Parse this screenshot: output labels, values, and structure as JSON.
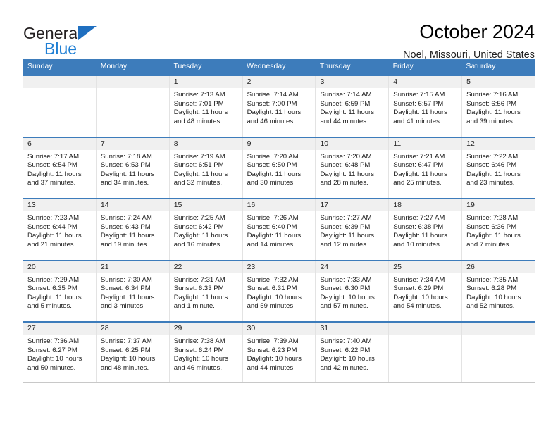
{
  "brand": {
    "name_top": "General",
    "name_bottom": "Blue",
    "triangle_color": "#1f6fc0",
    "blue_color": "#1f7fd4"
  },
  "header": {
    "title": "October 2024",
    "subtitle": "Noel, Missouri, United States"
  },
  "theme": {
    "header_bg": "#3d7cbb",
    "row_border": "#3d7cbb",
    "daynum_bg": "#f0f0f0"
  },
  "weekdays": [
    "Sunday",
    "Monday",
    "Tuesday",
    "Wednesday",
    "Thursday",
    "Friday",
    "Saturday"
  ],
  "weeks": [
    [
      {
        "day": "",
        "empty": true
      },
      {
        "day": "",
        "empty": true
      },
      {
        "day": "1",
        "sunrise": "Sunrise: 7:13 AM",
        "sunset": "Sunset: 7:01 PM",
        "daylight": "Daylight: 11 hours and 48 minutes."
      },
      {
        "day": "2",
        "sunrise": "Sunrise: 7:14 AM",
        "sunset": "Sunset: 7:00 PM",
        "daylight": "Daylight: 11 hours and 46 minutes."
      },
      {
        "day": "3",
        "sunrise": "Sunrise: 7:14 AM",
        "sunset": "Sunset: 6:59 PM",
        "daylight": "Daylight: 11 hours and 44 minutes."
      },
      {
        "day": "4",
        "sunrise": "Sunrise: 7:15 AM",
        "sunset": "Sunset: 6:57 PM",
        "daylight": "Daylight: 11 hours and 41 minutes."
      },
      {
        "day": "5",
        "sunrise": "Sunrise: 7:16 AM",
        "sunset": "Sunset: 6:56 PM",
        "daylight": "Daylight: 11 hours and 39 minutes."
      }
    ],
    [
      {
        "day": "6",
        "sunrise": "Sunrise: 7:17 AM",
        "sunset": "Sunset: 6:54 PM",
        "daylight": "Daylight: 11 hours and 37 minutes."
      },
      {
        "day": "7",
        "sunrise": "Sunrise: 7:18 AM",
        "sunset": "Sunset: 6:53 PM",
        "daylight": "Daylight: 11 hours and 34 minutes."
      },
      {
        "day": "8",
        "sunrise": "Sunrise: 7:19 AM",
        "sunset": "Sunset: 6:51 PM",
        "daylight": "Daylight: 11 hours and 32 minutes."
      },
      {
        "day": "9",
        "sunrise": "Sunrise: 7:20 AM",
        "sunset": "Sunset: 6:50 PM",
        "daylight": "Daylight: 11 hours and 30 minutes."
      },
      {
        "day": "10",
        "sunrise": "Sunrise: 7:20 AM",
        "sunset": "Sunset: 6:48 PM",
        "daylight": "Daylight: 11 hours and 28 minutes."
      },
      {
        "day": "11",
        "sunrise": "Sunrise: 7:21 AM",
        "sunset": "Sunset: 6:47 PM",
        "daylight": "Daylight: 11 hours and 25 minutes."
      },
      {
        "day": "12",
        "sunrise": "Sunrise: 7:22 AM",
        "sunset": "Sunset: 6:46 PM",
        "daylight": "Daylight: 11 hours and 23 minutes."
      }
    ],
    [
      {
        "day": "13",
        "sunrise": "Sunrise: 7:23 AM",
        "sunset": "Sunset: 6:44 PM",
        "daylight": "Daylight: 11 hours and 21 minutes."
      },
      {
        "day": "14",
        "sunrise": "Sunrise: 7:24 AM",
        "sunset": "Sunset: 6:43 PM",
        "daylight": "Daylight: 11 hours and 19 minutes."
      },
      {
        "day": "15",
        "sunrise": "Sunrise: 7:25 AM",
        "sunset": "Sunset: 6:42 PM",
        "daylight": "Daylight: 11 hours and 16 minutes."
      },
      {
        "day": "16",
        "sunrise": "Sunrise: 7:26 AM",
        "sunset": "Sunset: 6:40 PM",
        "daylight": "Daylight: 11 hours and 14 minutes."
      },
      {
        "day": "17",
        "sunrise": "Sunrise: 7:27 AM",
        "sunset": "Sunset: 6:39 PM",
        "daylight": "Daylight: 11 hours and 12 minutes."
      },
      {
        "day": "18",
        "sunrise": "Sunrise: 7:27 AM",
        "sunset": "Sunset: 6:38 PM",
        "daylight": "Daylight: 11 hours and 10 minutes."
      },
      {
        "day": "19",
        "sunrise": "Sunrise: 7:28 AM",
        "sunset": "Sunset: 6:36 PM",
        "daylight": "Daylight: 11 hours and 7 minutes."
      }
    ],
    [
      {
        "day": "20",
        "sunrise": "Sunrise: 7:29 AM",
        "sunset": "Sunset: 6:35 PM",
        "daylight": "Daylight: 11 hours and 5 minutes."
      },
      {
        "day": "21",
        "sunrise": "Sunrise: 7:30 AM",
        "sunset": "Sunset: 6:34 PM",
        "daylight": "Daylight: 11 hours and 3 minutes."
      },
      {
        "day": "22",
        "sunrise": "Sunrise: 7:31 AM",
        "sunset": "Sunset: 6:33 PM",
        "daylight": "Daylight: 11 hours and 1 minute."
      },
      {
        "day": "23",
        "sunrise": "Sunrise: 7:32 AM",
        "sunset": "Sunset: 6:31 PM",
        "daylight": "Daylight: 10 hours and 59 minutes."
      },
      {
        "day": "24",
        "sunrise": "Sunrise: 7:33 AM",
        "sunset": "Sunset: 6:30 PM",
        "daylight": "Daylight: 10 hours and 57 minutes."
      },
      {
        "day": "25",
        "sunrise": "Sunrise: 7:34 AM",
        "sunset": "Sunset: 6:29 PM",
        "daylight": "Daylight: 10 hours and 54 minutes."
      },
      {
        "day": "26",
        "sunrise": "Sunrise: 7:35 AM",
        "sunset": "Sunset: 6:28 PM",
        "daylight": "Daylight: 10 hours and 52 minutes."
      }
    ],
    [
      {
        "day": "27",
        "sunrise": "Sunrise: 7:36 AM",
        "sunset": "Sunset: 6:27 PM",
        "daylight": "Daylight: 10 hours and 50 minutes."
      },
      {
        "day": "28",
        "sunrise": "Sunrise: 7:37 AM",
        "sunset": "Sunset: 6:25 PM",
        "daylight": "Daylight: 10 hours and 48 minutes."
      },
      {
        "day": "29",
        "sunrise": "Sunrise: 7:38 AM",
        "sunset": "Sunset: 6:24 PM",
        "daylight": "Daylight: 10 hours and 46 minutes."
      },
      {
        "day": "30",
        "sunrise": "Sunrise: 7:39 AM",
        "sunset": "Sunset: 6:23 PM",
        "daylight": "Daylight: 10 hours and 44 minutes."
      },
      {
        "day": "31",
        "sunrise": "Sunrise: 7:40 AM",
        "sunset": "Sunset: 6:22 PM",
        "daylight": "Daylight: 10 hours and 42 minutes."
      },
      {
        "day": "",
        "empty": true
      },
      {
        "day": "",
        "empty": true
      }
    ]
  ]
}
